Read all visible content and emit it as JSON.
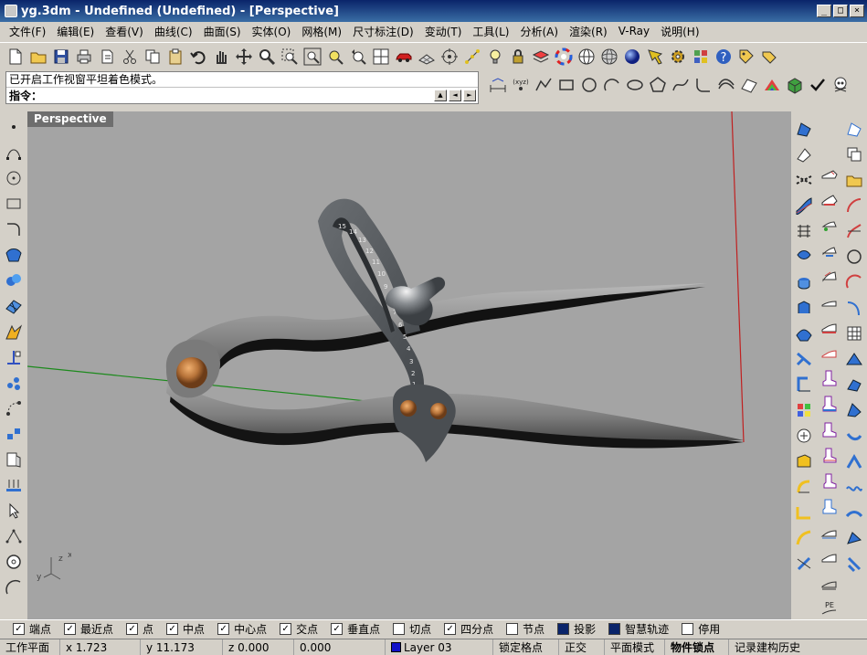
{
  "window": {
    "title": "yg.3dm - Undefined (Undefined) - [Perspective]",
    "minimize_glyph": "_",
    "restore_glyph": "□",
    "close_glyph": "×"
  },
  "menu": [
    "文件(F)",
    "编辑(E)",
    "查看(V)",
    "曲线(C)",
    "曲面(S)",
    "实体(O)",
    "网格(M)",
    "尺寸标注(D)",
    "变动(T)",
    "工具(L)",
    "分析(A)",
    "渲染(R)",
    "V-Ray",
    "说明(H)"
  ],
  "command": {
    "history": "已开启工作视窗平坦着色模式。",
    "prompt": "指令：",
    "value": "",
    "scroll_up": "▲",
    "nav_left": "◄",
    "nav_right": "►"
  },
  "viewport": {
    "label": "Perspective",
    "axis_x": "x",
    "axis_y": "y",
    "axis_z": "z"
  },
  "curve_toolbar": {
    "xyz_label": "(xyz)"
  },
  "osnaps": [
    {
      "label": "端点",
      "checked": true
    },
    {
      "label": "最近点",
      "checked": true
    },
    {
      "label": "点",
      "checked": true
    },
    {
      "label": "中点",
      "checked": true
    },
    {
      "label": "中心点",
      "checked": true
    },
    {
      "label": "交点",
      "checked": true
    },
    {
      "label": "垂直点",
      "checked": true
    },
    {
      "label": "切点",
      "checked": false
    },
    {
      "label": "四分点",
      "checked": true
    },
    {
      "label": "节点",
      "checked": false
    },
    {
      "label": "投影",
      "checked": true,
      "filled": true
    },
    {
      "label": "智慧轨迹",
      "checked": true,
      "filled": true
    },
    {
      "label": "停用",
      "checked": false
    }
  ],
  "status": {
    "cplane": "工作平面",
    "x": "x 1.723",
    "y": "y 11.173",
    "z": "z 0.000",
    "dist": "0.000",
    "layer": "Layer 03",
    "layer_color": "#1010c8",
    "grid_snap": "锁定格点",
    "ortho": "正交",
    "planar": "平面模式",
    "osnap": "物件锁点",
    "history": "记录建构历史"
  },
  "model": {
    "scale_numbers": [
      "1",
      "2",
      "3",
      "4",
      "5",
      "6",
      "7",
      "8",
      "9",
      "10",
      "11",
      "12",
      "13",
      "14",
      "15"
    ]
  }
}
